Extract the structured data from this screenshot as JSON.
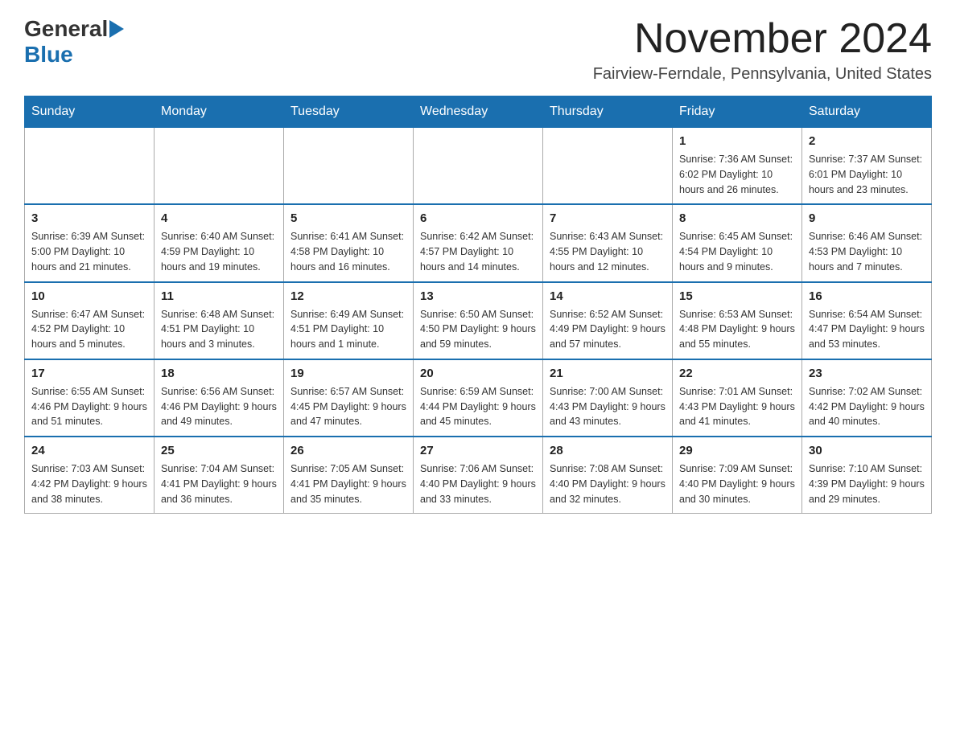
{
  "header": {
    "logo_general": "General",
    "logo_blue": "Blue",
    "month_title": "November 2024",
    "subtitle": "Fairview-Ferndale, Pennsylvania, United States"
  },
  "days_of_week": [
    "Sunday",
    "Monday",
    "Tuesday",
    "Wednesday",
    "Thursday",
    "Friday",
    "Saturday"
  ],
  "weeks": [
    {
      "days": [
        {
          "number": "",
          "info": ""
        },
        {
          "number": "",
          "info": ""
        },
        {
          "number": "",
          "info": ""
        },
        {
          "number": "",
          "info": ""
        },
        {
          "number": "",
          "info": ""
        },
        {
          "number": "1",
          "info": "Sunrise: 7:36 AM\nSunset: 6:02 PM\nDaylight: 10 hours and 26 minutes."
        },
        {
          "number": "2",
          "info": "Sunrise: 7:37 AM\nSunset: 6:01 PM\nDaylight: 10 hours and 23 minutes."
        }
      ]
    },
    {
      "days": [
        {
          "number": "3",
          "info": "Sunrise: 6:39 AM\nSunset: 5:00 PM\nDaylight: 10 hours and 21 minutes."
        },
        {
          "number": "4",
          "info": "Sunrise: 6:40 AM\nSunset: 4:59 PM\nDaylight: 10 hours and 19 minutes."
        },
        {
          "number": "5",
          "info": "Sunrise: 6:41 AM\nSunset: 4:58 PM\nDaylight: 10 hours and 16 minutes."
        },
        {
          "number": "6",
          "info": "Sunrise: 6:42 AM\nSunset: 4:57 PM\nDaylight: 10 hours and 14 minutes."
        },
        {
          "number": "7",
          "info": "Sunrise: 6:43 AM\nSunset: 4:55 PM\nDaylight: 10 hours and 12 minutes."
        },
        {
          "number": "8",
          "info": "Sunrise: 6:45 AM\nSunset: 4:54 PM\nDaylight: 10 hours and 9 minutes."
        },
        {
          "number": "9",
          "info": "Sunrise: 6:46 AM\nSunset: 4:53 PM\nDaylight: 10 hours and 7 minutes."
        }
      ]
    },
    {
      "days": [
        {
          "number": "10",
          "info": "Sunrise: 6:47 AM\nSunset: 4:52 PM\nDaylight: 10 hours and 5 minutes."
        },
        {
          "number": "11",
          "info": "Sunrise: 6:48 AM\nSunset: 4:51 PM\nDaylight: 10 hours and 3 minutes."
        },
        {
          "number": "12",
          "info": "Sunrise: 6:49 AM\nSunset: 4:51 PM\nDaylight: 10 hours and 1 minute."
        },
        {
          "number": "13",
          "info": "Sunrise: 6:50 AM\nSunset: 4:50 PM\nDaylight: 9 hours and 59 minutes."
        },
        {
          "number": "14",
          "info": "Sunrise: 6:52 AM\nSunset: 4:49 PM\nDaylight: 9 hours and 57 minutes."
        },
        {
          "number": "15",
          "info": "Sunrise: 6:53 AM\nSunset: 4:48 PM\nDaylight: 9 hours and 55 minutes."
        },
        {
          "number": "16",
          "info": "Sunrise: 6:54 AM\nSunset: 4:47 PM\nDaylight: 9 hours and 53 minutes."
        }
      ]
    },
    {
      "days": [
        {
          "number": "17",
          "info": "Sunrise: 6:55 AM\nSunset: 4:46 PM\nDaylight: 9 hours and 51 minutes."
        },
        {
          "number": "18",
          "info": "Sunrise: 6:56 AM\nSunset: 4:46 PM\nDaylight: 9 hours and 49 minutes."
        },
        {
          "number": "19",
          "info": "Sunrise: 6:57 AM\nSunset: 4:45 PM\nDaylight: 9 hours and 47 minutes."
        },
        {
          "number": "20",
          "info": "Sunrise: 6:59 AM\nSunset: 4:44 PM\nDaylight: 9 hours and 45 minutes."
        },
        {
          "number": "21",
          "info": "Sunrise: 7:00 AM\nSunset: 4:43 PM\nDaylight: 9 hours and 43 minutes."
        },
        {
          "number": "22",
          "info": "Sunrise: 7:01 AM\nSunset: 4:43 PM\nDaylight: 9 hours and 41 minutes."
        },
        {
          "number": "23",
          "info": "Sunrise: 7:02 AM\nSunset: 4:42 PM\nDaylight: 9 hours and 40 minutes."
        }
      ]
    },
    {
      "days": [
        {
          "number": "24",
          "info": "Sunrise: 7:03 AM\nSunset: 4:42 PM\nDaylight: 9 hours and 38 minutes."
        },
        {
          "number": "25",
          "info": "Sunrise: 7:04 AM\nSunset: 4:41 PM\nDaylight: 9 hours and 36 minutes."
        },
        {
          "number": "26",
          "info": "Sunrise: 7:05 AM\nSunset: 4:41 PM\nDaylight: 9 hours and 35 minutes."
        },
        {
          "number": "27",
          "info": "Sunrise: 7:06 AM\nSunset: 4:40 PM\nDaylight: 9 hours and 33 minutes."
        },
        {
          "number": "28",
          "info": "Sunrise: 7:08 AM\nSunset: 4:40 PM\nDaylight: 9 hours and 32 minutes."
        },
        {
          "number": "29",
          "info": "Sunrise: 7:09 AM\nSunset: 4:40 PM\nDaylight: 9 hours and 30 minutes."
        },
        {
          "number": "30",
          "info": "Sunrise: 7:10 AM\nSunset: 4:39 PM\nDaylight: 9 hours and 29 minutes."
        }
      ]
    }
  ]
}
